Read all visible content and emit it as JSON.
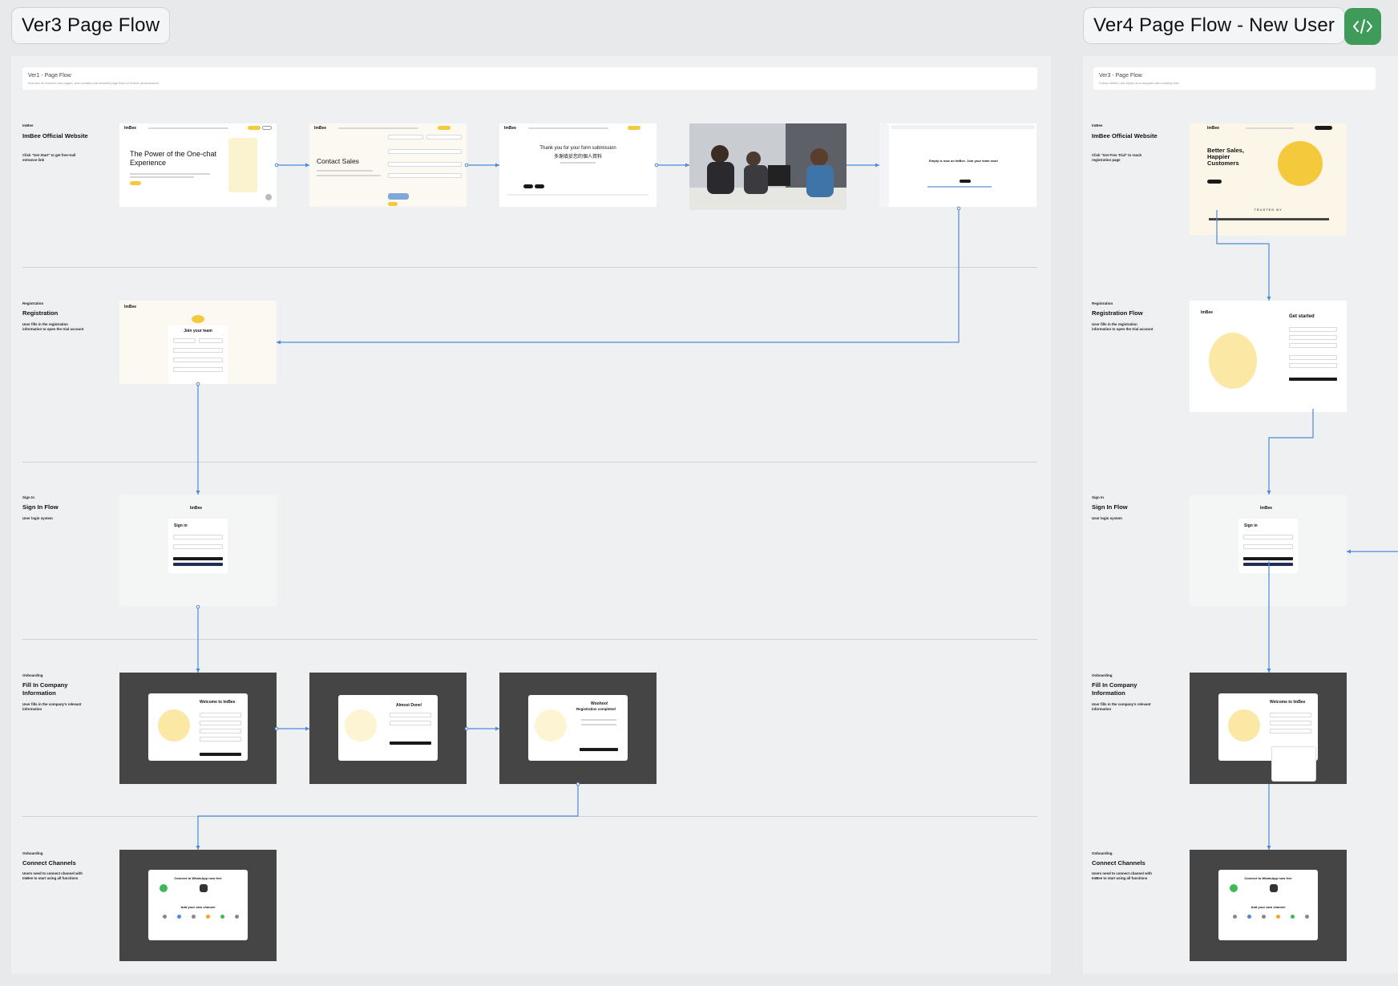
{
  "tags": {
    "ver3": "Ver3 Page Flow",
    "ver4": "Ver4 Page Flow - New User"
  },
  "code_icon": "code-icon",
  "colors": {
    "accent": "#f5c93c",
    "code_button": "#3f9b5a",
    "connector": "#4a89dc"
  },
  "board_left": {
    "header_title": "Ver1 - Page Flow",
    "header_sub": "Includes all features and pages, and contains the detailed page flow for further development",
    "lanes": [
      {
        "kicker": "ImBee",
        "title": "ImBee Official Website",
        "desc": "Click \"Get Start\" to get free-trail entrance link"
      },
      {
        "kicker": "Registration",
        "title": "Registration",
        "desc": "User fills in the registration information to open the trial account"
      },
      {
        "kicker": "Sign In",
        "title": "Sign In Flow",
        "desc": "User login system"
      },
      {
        "kicker": "Onboarding",
        "title": "Fill In Company Information",
        "desc": "User fills in the company's relevant information"
      },
      {
        "kicker": "Onboarding",
        "title": "Connect Channels",
        "desc": "Users need to connect channel with ImBee to start using all functions"
      }
    ],
    "frames": {
      "home_hero": "The Power of the One-chat Experience",
      "contact_sales": "Contact Sales",
      "thank_you": "Thank you for your form submission",
      "thank_you_cn": "多謝填妥您的個人資料",
      "email_heading": "Empty is now on ImBee. Join your team now!",
      "join_team": "Join your team",
      "sign_in": "Sign in",
      "welcome": "Welcome to ImBee",
      "almost_done": "Almost Done!",
      "woohoo": "Woohoo!",
      "registration_completed": "Registration completed",
      "connect_whatsapp": "Connect to WhatsApp now free",
      "add_own_channel": "Add your own channel"
    }
  },
  "board_right": {
    "header_title": "Ver3 - Page Flow",
    "header_sub": "Follow ImBee new styles and integrate with existing flow",
    "lanes": [
      {
        "kicker": "ImBee",
        "title": "ImBee Official Website",
        "desc": "Click \"Get Free Trial\" to reach registration page"
      },
      {
        "kicker": "Registration",
        "title": "Registration Flow",
        "desc": "User fills in the registration information to open the trial account"
      },
      {
        "kicker": "Sign In",
        "title": "Sign In Flow",
        "desc": "User login system"
      },
      {
        "kicker": "Onboarding",
        "title": "Fill In Company Information",
        "desc": "User fills in the company's relevant information"
      },
      {
        "kicker": "Onboarding",
        "title": "Connect Channels",
        "desc": "Users need to connect channel with ImBee to start using all functions"
      }
    ],
    "frames": {
      "hero": "Better Sales, Happier Customers",
      "trusted_by": "TRUSTED BY",
      "get_started": "Get started",
      "sign_in": "Sign in",
      "welcome": "Welcome to ImBee",
      "connect_whatsapp": "Connect to WhatsApp now free",
      "add_own_channel": "Add your own channel"
    }
  },
  "brand": "ImBee"
}
